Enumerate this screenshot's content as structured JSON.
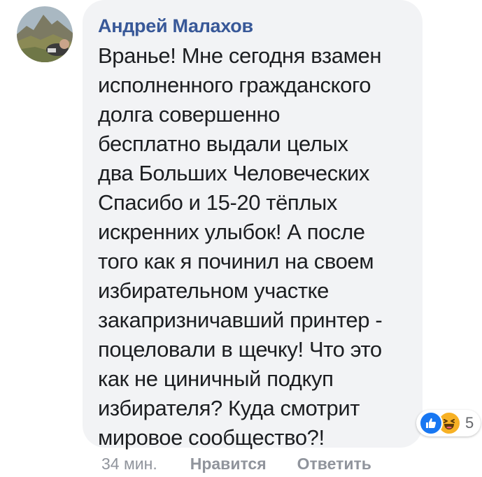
{
  "comment": {
    "author": "Андрей Малахов",
    "text_lines": [
      "Вранье! Мне сегодня взамен",
      "исполненного гражданского",
      "долга совершенно",
      "бесплатно выдали целых",
      "два Больших Человеческих",
      "Спасибо и 15-20 тёплых",
      "искренних улыбок! А после",
      "того как я починил на своем",
      "избирательном участке",
      "закапризничавший принтер -",
      "поцеловали в щечку! Что это",
      "как не циничный подкуп",
      "избирателя? Куда смотрит",
      "мировое сообщество?!"
    ],
    "timestamp": "34 мин.",
    "like_label": "Нравится",
    "reply_label": "Ответить"
  },
  "reactions": {
    "icons": [
      "like-icon",
      "haha-icon"
    ],
    "count": "5"
  },
  "colors": {
    "bubble_bg": "#f2f3f5",
    "author": "#385898",
    "text": "#1c1e21",
    "meta": "#90949c",
    "like_blue": "#1877f2",
    "haha_yellow": "#f7b125"
  }
}
